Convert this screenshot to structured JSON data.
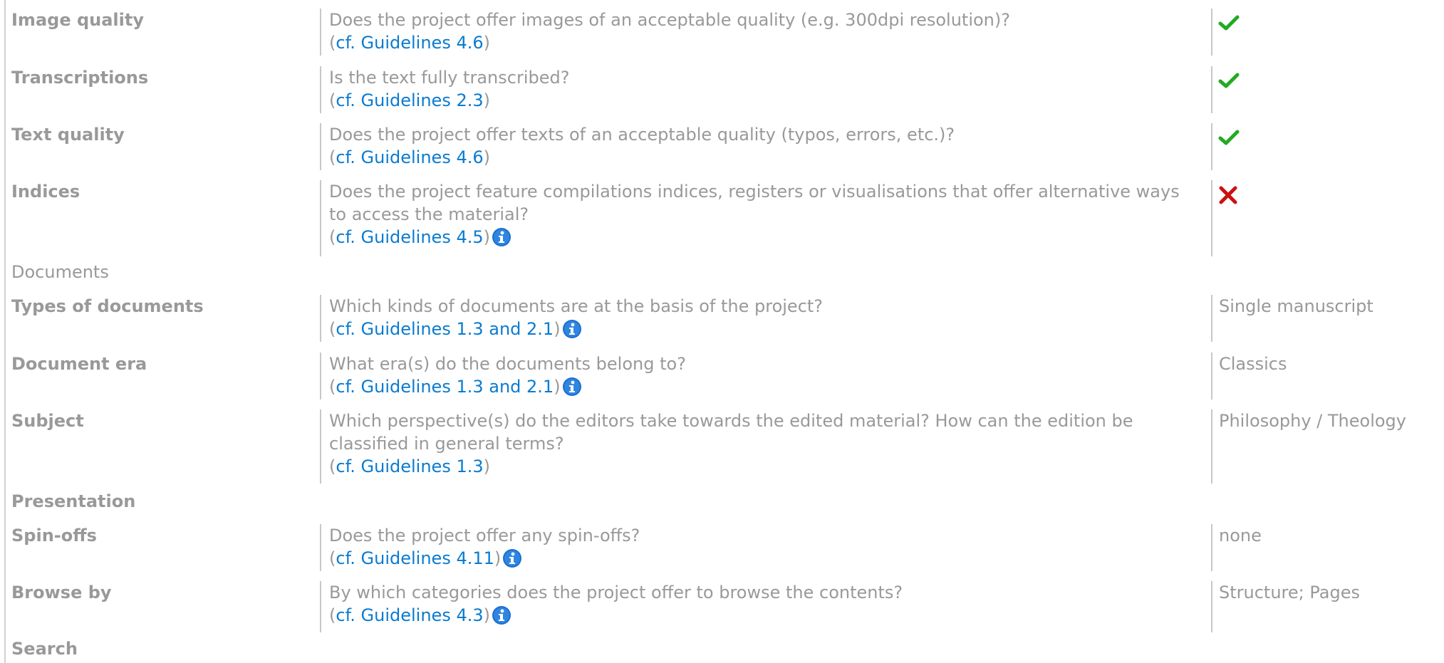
{
  "colors": {
    "link": "#0a7bd0",
    "check": "#22aa22",
    "cross": "#cc1111",
    "info": "#1a6fcf"
  },
  "rows_top": [
    {
      "label": "Image quality",
      "question": "Does the project offer images of an acceptable quality (e.g. 300dpi resolution)?",
      "ref": "cf. Guidelines 4.6",
      "answer_icon": "check-icon"
    },
    {
      "label": "Transcriptions",
      "question": "Is the text fully transcribed?",
      "ref": "cf. Guidelines 2.3",
      "answer_icon": "check-icon"
    },
    {
      "label": "Text quality",
      "question": "Does the project offer texts of an acceptable quality (typos, errors, etc.)?",
      "ref": "cf. Guidelines 4.6",
      "answer_icon": "check-icon"
    },
    {
      "label": "Indices",
      "question_line1": "Does the project feature compilations indices, registers or visualisations that offer alternative ways",
      "question_line2": "to access the material?",
      "ref": "cf. Guidelines 4.5",
      "answer_icon": "cross-icon",
      "has_info": true
    }
  ],
  "section_documents": "Documents",
  "rows_documents": [
    {
      "label": "Types of documents",
      "question": "Which kinds of documents are at the basis of the project?",
      "ref": "cf. Guidelines 1.3 and 2.1",
      "answer": "Single manuscript",
      "has_info": true
    },
    {
      "label": "Document era",
      "question": "What era(s) do the documents belong to?",
      "ref": "cf. Guidelines 1.3 and 2.1",
      "answer": "Classics",
      "has_info": true
    },
    {
      "label": "Subject",
      "question_line1": "Which perspective(s) do the editors take towards the edited material? How can the edition be",
      "question_line2": "classified in general terms?",
      "ref": "cf. Guidelines 1.3",
      "answer": "Philosophy / Theology"
    }
  ],
  "section_presentation": "Presentation",
  "rows_presentation": [
    {
      "label": "Spin-offs",
      "question": "Does the project offer any spin-offs?",
      "ref": "cf. Guidelines 4.11",
      "answer": "none",
      "has_info": true
    },
    {
      "label": "Browse by",
      "question": "By which categories does the project offer to browse the contents?",
      "ref": "cf. Guidelines 4.3",
      "answer": "Structure; Pages",
      "has_info": true
    }
  ],
  "section_search": "Search",
  "punct": {
    "open": "(",
    "close": ")"
  }
}
